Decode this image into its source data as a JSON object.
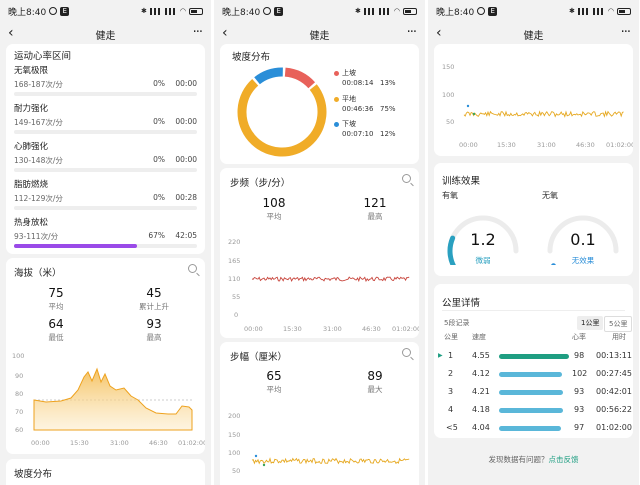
{
  "status": {
    "time": "晚上8:40",
    "badge": "E",
    "battery": "80"
  },
  "nav": {
    "title": "健走",
    "back": "‹",
    "more": "···"
  },
  "hr_zones": {
    "title": "运动心率区间",
    "items": [
      {
        "name": "无氧极限",
        "range": "168-187次/分",
        "pct": "0%",
        "time": "00:00",
        "fill": 0
      },
      {
        "name": "耐力强化",
        "range": "149-167次/分",
        "pct": "0%",
        "time": "00:00",
        "fill": 0
      },
      {
        "name": "心肺强化",
        "range": "130-148次/分",
        "pct": "0%",
        "time": "00:00",
        "fill": 0
      },
      {
        "name": "脂肪燃烧",
        "range": "112-129次/分",
        "pct": "0%",
        "time": "00:28",
        "fill": 0
      },
      {
        "name": "热身放松",
        "range": "93-111次/分",
        "pct": "67%",
        "time": "42:05",
        "fill": 0.67
      }
    ]
  },
  "altitude": {
    "title": "海拔（米）",
    "stats": [
      {
        "value": "75",
        "label": "平均"
      },
      {
        "value": "45",
        "label": "累计上升"
      },
      {
        "value": "64",
        "label": "最低"
      },
      {
        "value": "93",
        "label": "最高"
      }
    ],
    "y_ticks": [
      "100",
      "90",
      "80",
      "70",
      "60"
    ],
    "x_ticks": [
      "00:00",
      "15:30",
      "31:00",
      "46:30",
      "01:02:00"
    ]
  },
  "slope_card_bottom": {
    "title": "坡度分布"
  },
  "slope": {
    "title": "坡度分布",
    "items": [
      {
        "name": "上坡",
        "time": "00:08:14",
        "pct": "13%",
        "color": "#e8615a",
        "value": 13
      },
      {
        "name": "平地",
        "time": "00:46:36",
        "pct": "75%",
        "color": "#f0ac28",
        "value": 75
      },
      {
        "name": "下坡",
        "time": "00:07:10",
        "pct": "12%",
        "color": "#2a8ed8",
        "value": 12
      }
    ]
  },
  "cadence": {
    "title": "步频（步/分）",
    "stats": [
      {
        "value": "108",
        "label": "平均"
      },
      {
        "value": "121",
        "label": "最高"
      }
    ],
    "y_ticks": [
      "220",
      "165",
      "110",
      "55",
      "0"
    ],
    "x_ticks": [
      "00:00",
      "15:30",
      "31:00",
      "46:30",
      "01:02:00"
    ]
  },
  "stride": {
    "title": "步幅（厘米）",
    "stats": [
      {
        "value": "65",
        "label": "平均"
      },
      {
        "value": "89",
        "label": "最大"
      }
    ],
    "y_ticks": [
      "200",
      "150",
      "100",
      "50"
    ]
  },
  "stride_top": {
    "y_ticks": [
      "150",
      "100",
      "50"
    ],
    "x_ticks": [
      "00:00",
      "15:30",
      "31:00",
      "46:30",
      "01:02:00"
    ]
  },
  "training": {
    "title": "训练效果",
    "aerobic": {
      "label": "有氧",
      "value": "1.2",
      "desc": "微弱",
      "level": 0.24
    },
    "anaerobic": {
      "label": "无氧",
      "value": "0.1",
      "desc": "无效果",
      "level": 0.02
    }
  },
  "km": {
    "title": "公里详情",
    "records": "5段记录",
    "tabs": [
      "1公里",
      "5公里"
    ],
    "headers": [
      "公里",
      "速度",
      "心率",
      "用时"
    ],
    "rows": [
      {
        "km": "1",
        "speed": "4.55",
        "hr": "98",
        "time": "00:13:11",
        "fill": 1.0,
        "best": true
      },
      {
        "km": "2",
        "speed": "4.12",
        "hr": "102",
        "time": "00:27:45",
        "fill": 0.9
      },
      {
        "km": "3",
        "speed": "4.21",
        "hr": "93",
        "time": "00:42:01",
        "fill": 0.92
      },
      {
        "km": "4",
        "speed": "4.18",
        "hr": "93",
        "time": "00:56:22",
        "fill": 0.91
      },
      {
        "km": "<5",
        "speed": "4.04",
        "hr": "97",
        "time": "01:02:00",
        "fill": 0.88
      }
    ]
  },
  "feedback": {
    "question": "发现数据有问题？",
    "link": "点击反馈"
  }
}
